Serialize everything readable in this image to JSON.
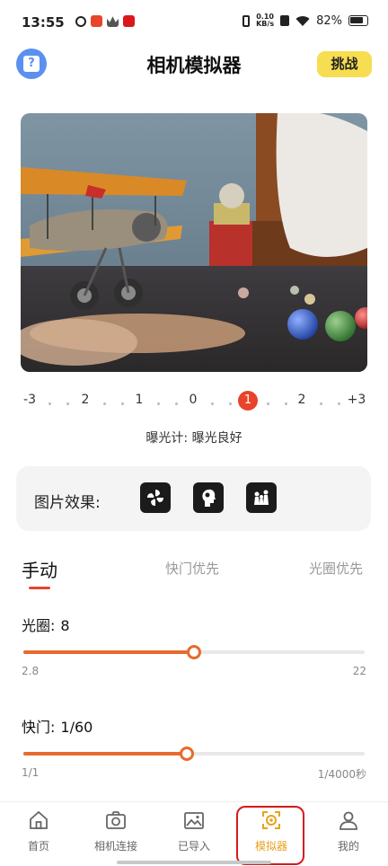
{
  "status_bar": {
    "time": "13:55",
    "net_speed_value": "0.10",
    "net_speed_unit": "KB/s",
    "battery": "82%"
  },
  "header": {
    "title": "相机模拟器",
    "challenge_button": "挑战",
    "help_icon": "help-icon"
  },
  "exposure": {
    "scale_labels": [
      "-3",
      "2",
      "1",
      "0",
      "1",
      "2",
      "+3"
    ],
    "current_label": "1",
    "meter_text": "曝光计: 曝光良好"
  },
  "effects": {
    "label": "图片效果:",
    "icons": [
      "fan-icon",
      "portrait-icon",
      "chess-icon"
    ]
  },
  "modes": {
    "tabs": [
      "手动",
      "快门优先",
      "光圈优先"
    ],
    "active": "手动"
  },
  "aperture": {
    "label": "光圈:",
    "value": "8",
    "min": "2.8",
    "max": "22",
    "level": 0.5
  },
  "shutter": {
    "label": "快门:",
    "value": "1/60",
    "min": "1/1",
    "max": "1/4000秒",
    "level": 0.48
  },
  "nav": {
    "items": [
      {
        "label": "首页",
        "icon": "home-icon"
      },
      {
        "label": "相机连接",
        "icon": "camera-icon"
      },
      {
        "label": "已导入",
        "icon": "image-icon"
      },
      {
        "label": "模拟器",
        "icon": "simulator-icon"
      },
      {
        "label": "我的",
        "icon": "user-icon"
      }
    ],
    "active": "模拟器"
  },
  "colors": {
    "accent": "#e86a2e",
    "ev_marker": "#e8432b",
    "challenge": "#f7dd50",
    "nav_active": "#e8a21b",
    "help": "#5b8ff0"
  }
}
